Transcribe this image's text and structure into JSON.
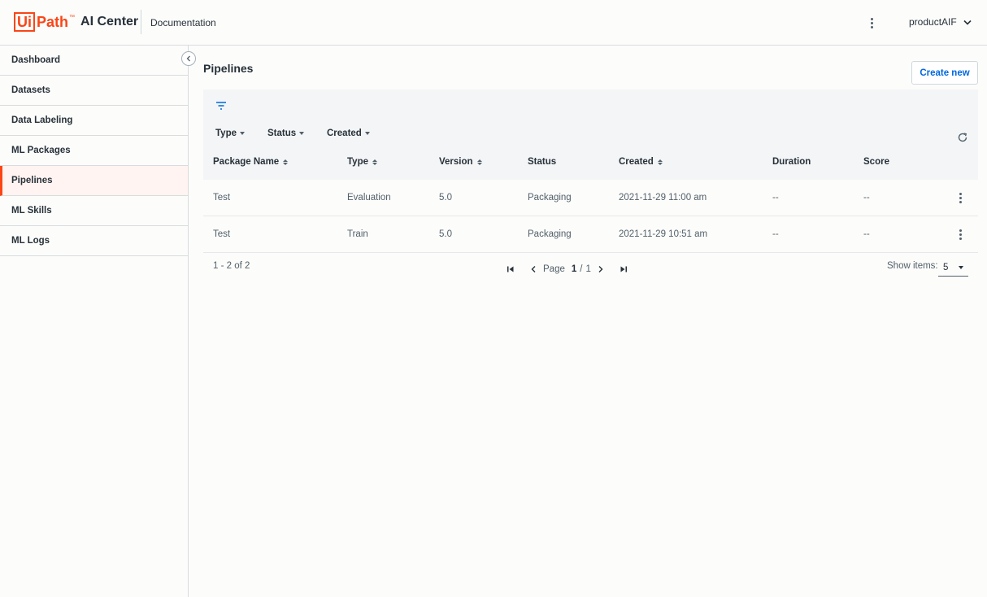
{
  "header": {
    "logo_ui": "Ui",
    "logo_path": "Path",
    "logo_tm": "™",
    "product_name": "AI Center",
    "documentation_link": "Documentation",
    "user_name": "productAIF"
  },
  "sidebar": {
    "items": [
      {
        "label": "Dashboard",
        "active": false
      },
      {
        "label": "Datasets",
        "active": false
      },
      {
        "label": "Data Labeling",
        "active": false
      },
      {
        "label": "ML Packages",
        "active": false
      },
      {
        "label": "Pipelines",
        "active": true
      },
      {
        "label": "ML Skills",
        "active": false
      },
      {
        "label": "ML Logs",
        "active": false
      }
    ]
  },
  "main": {
    "title": "Pipelines",
    "create_button": "Create new",
    "filters": [
      "Type",
      "Status",
      "Created"
    ],
    "columns": [
      "Package Name",
      "Type",
      "Version",
      "Status",
      "Created",
      "Duration",
      "Score"
    ],
    "rows": [
      {
        "package_name": "Test",
        "type": "Evaluation",
        "version": "5.0",
        "status": "Packaging",
        "created": "2021-11-29 11:00 am",
        "duration": "--",
        "score": "--"
      },
      {
        "package_name": "Test",
        "type": "Train",
        "version": "5.0",
        "status": "Packaging",
        "created": "2021-11-29 10:51 am",
        "duration": "--",
        "score": "--"
      }
    ],
    "pagination": {
      "range_text": "1 - 2 of 2",
      "page_label": "Page",
      "current_page": "1",
      "separator": "/",
      "total_pages": "1",
      "show_items_label": "Show items:",
      "page_size": "5"
    }
  },
  "colors": {
    "brand": "#fa4616",
    "link": "#0067df",
    "table_header_bg": "#f4f5f7",
    "active_nav_bg": "#fff4f1"
  },
  "icons": [
    "kebab-icon",
    "chevron-down-icon",
    "collapse-chevron-icon",
    "filter-icon",
    "refresh-icon",
    "sort-icon",
    "first-page-icon",
    "prev-page-icon",
    "next-page-icon",
    "last-page-icon",
    "dropdown-arrow-icon"
  ]
}
